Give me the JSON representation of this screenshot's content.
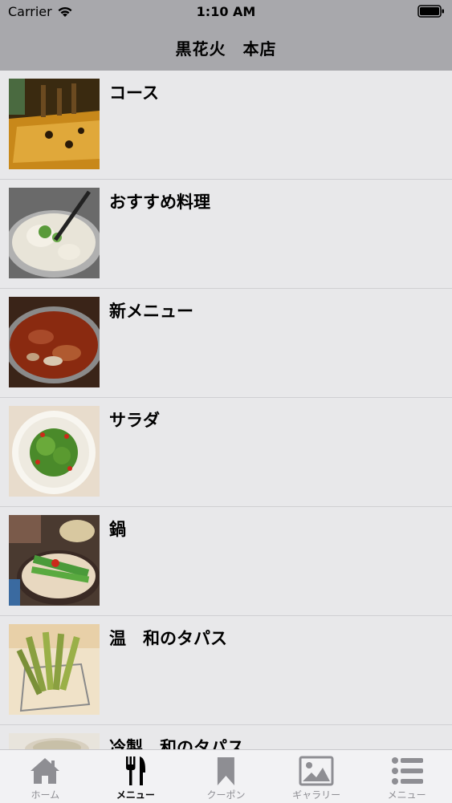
{
  "status_bar": {
    "carrier": "Carrier",
    "time": "1:10 AM",
    "wifi_icon": "wifi-icon",
    "battery_icon": "battery-icon"
  },
  "nav": {
    "title": "黒花火　本店"
  },
  "menu_items": [
    {
      "label": "コース",
      "image": "restaurant-interior"
    },
    {
      "label": "おすすめ料理",
      "image": "hotpot-ladle"
    },
    {
      "label": "新メニュー",
      "image": "stew-dish"
    },
    {
      "label": "サラダ",
      "image": "salad-plate"
    },
    {
      "label": "鍋",
      "image": "motsunabe-set"
    },
    {
      "label": "温　和のタパス",
      "image": "fried-okra-basket"
    },
    {
      "label": "冷製　和のタパス",
      "image": "cold-dish"
    }
  ],
  "tab_bar": {
    "active_index": 1,
    "tabs": [
      {
        "label": "ホーム",
        "icon": "home-icon"
      },
      {
        "label": "メニュー",
        "icon": "fork-knife-icon"
      },
      {
        "label": "クーポン",
        "icon": "bookmark-icon"
      },
      {
        "label": "ギャラリー",
        "icon": "photo-icon"
      },
      {
        "label": "メニュー",
        "icon": "list-icon"
      }
    ]
  },
  "colors": {
    "header_bg": "#a8a8ac",
    "list_bg": "#e8e8ea",
    "tab_bar_bg": "#f2f2f4",
    "tab_inactive": "#8e8e93",
    "tab_active": "#000000"
  }
}
